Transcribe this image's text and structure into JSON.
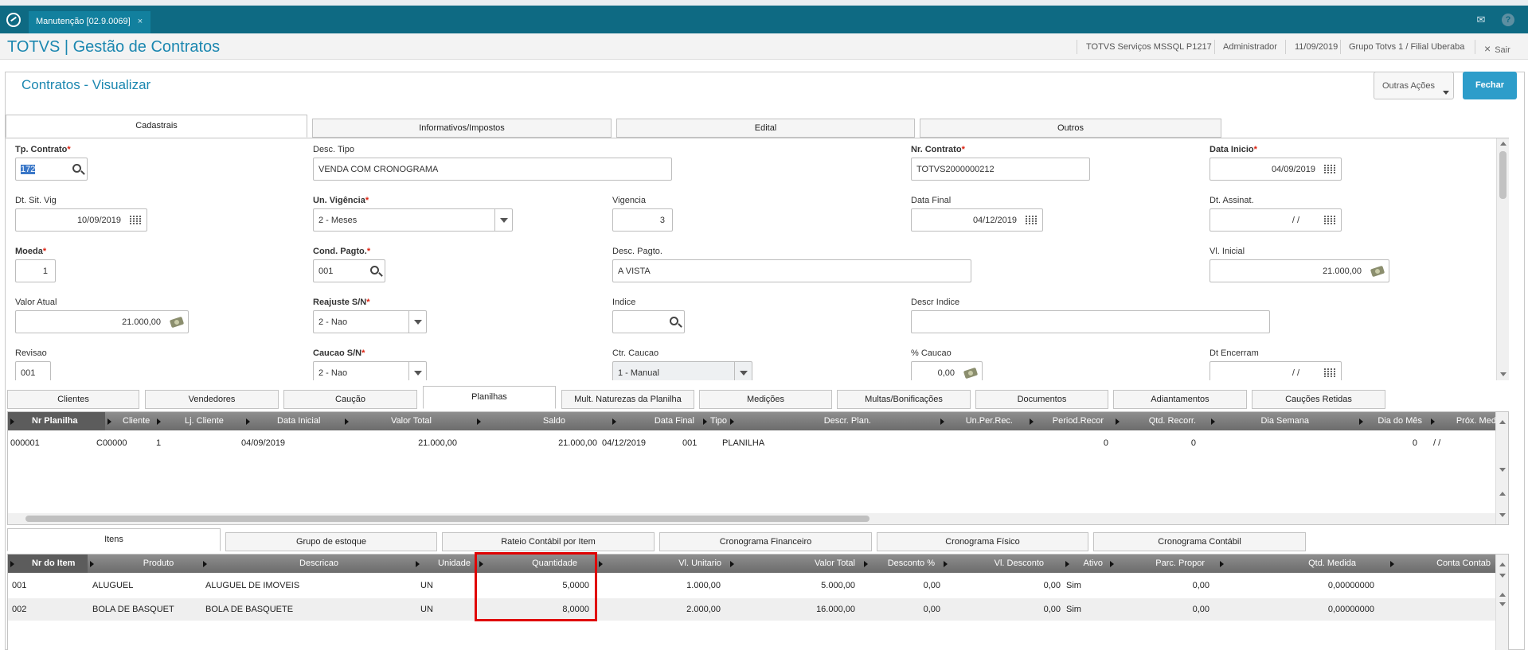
{
  "window": {
    "tab_label": "Manutenção [02.9.0069]",
    "tab_close": "×"
  },
  "header": {
    "title": "TOTVS | Gestão de Contratos",
    "company": "TOTVS Serviços MSSQL P1217",
    "user": "Administrador",
    "date": "11/09/2019",
    "branch": "Grupo Totvs 1 / Filial Uberaba",
    "exit_label": "Sair",
    "exit_icon": "×"
  },
  "page": {
    "title": "Contratos - Visualizar",
    "actions_label": "Outras Ações",
    "close_label": "Fechar"
  },
  "top_tabs": [
    "Cadastrais",
    "Informativos/Impostos",
    "Edital",
    "Outros"
  ],
  "form": {
    "tp_contrato": {
      "label": "Tp. Contrato",
      "value": "172"
    },
    "desc_tipo": {
      "label": "Desc. Tipo",
      "value": "VENDA COM CRONOGRAMA"
    },
    "nr_contrato": {
      "label": "Nr. Contrato",
      "value": "TOTVS2000000212"
    },
    "data_inicio": {
      "label": "Data Inicio",
      "value": "04/09/2019"
    },
    "dt_sit_vig": {
      "label": "Dt. Sit. Vig",
      "value": "10/09/2019"
    },
    "un_vigencia": {
      "label": "Un. Vigência",
      "value": "2 - Meses"
    },
    "vigencia": {
      "label": "Vigencia",
      "value": "3"
    },
    "data_final": {
      "label": "Data Final",
      "value": "04/12/2019"
    },
    "dt_assinat": {
      "label": "Dt. Assinat.",
      "value": "/ /"
    },
    "moeda": {
      "label": "Moeda",
      "value": "1"
    },
    "cond_pagto": {
      "label": "Cond. Pagto.",
      "value": "001"
    },
    "desc_pagto": {
      "label": "Desc. Pagto.",
      "value": "A VISTA"
    },
    "vl_inicial": {
      "label": "Vl. Inicial",
      "value": "21.000,00"
    },
    "valor_atual": {
      "label": "Valor Atual",
      "value": "21.000,00"
    },
    "reajuste": {
      "label": "Reajuste S/N",
      "value": "2 - Nao"
    },
    "indice": {
      "label": "Indice",
      "value": ""
    },
    "descr_indice": {
      "label": "Descr Indice",
      "value": ""
    },
    "revisao": {
      "label": "Revisao",
      "value": "001"
    },
    "caucao": {
      "label": "Caucao S/N",
      "value": "2 - Nao"
    },
    "ctr_caucao": {
      "label": "Ctr. Caucao",
      "value": "1 - Manual"
    },
    "pct_caucao": {
      "label": "% Caucao",
      "value": "0,00"
    },
    "dt_encerram": {
      "label": "Dt Encerram",
      "value": "/ /"
    }
  },
  "mid_tabs": [
    "Clientes",
    "Vendedores",
    "Caução",
    "Planilhas",
    "Mult. Naturezas da Planilha",
    "Medições",
    "Multas/Bonificações",
    "Documentos",
    "Adiantamentos",
    "Cauções Retidas"
  ],
  "planilhas_grid": {
    "columns": [
      "Nr Planilha",
      "Cliente",
      "Lj. Cliente",
      "Data Inicial",
      "Valor Total",
      "Saldo",
      "Data Final",
      "Tipo",
      "Descr. Plan.",
      "Un.Per.Rec.",
      "Period.Recor",
      "Qtd. Recorr.",
      "Dia Semana",
      "Dia do Mês",
      "Próx. Med."
    ],
    "rows": [
      [
        "000001",
        "C00000",
        "1",
        "04/09/2019",
        "21.000,00",
        "21.000,00",
        "04/12/2019",
        "001",
        "PLANILHA",
        "",
        "0",
        "0",
        "",
        "0",
        "/ /"
      ]
    ]
  },
  "bottom_tabs": [
    "Itens",
    "Grupo de estoque",
    "Rateio Contábil por Item",
    "Cronograma Financeiro",
    "Cronograma Físico",
    "Cronograma Contábil"
  ],
  "itens_grid": {
    "columns": [
      "Nr do Item",
      "Produto",
      "Descricao",
      "Unidade",
      "Quantidade",
      "Vl. Unitario",
      "Valor Total",
      "Desconto %",
      "Vl. Desconto",
      "Ativo",
      "Parc. Propor",
      "Qtd. Medida",
      "Conta Contab"
    ],
    "rows": [
      [
        "001",
        "ALUGUEL",
        "ALUGUEL DE IMOVEIS",
        "UN",
        "5,0000",
        "1.000,00",
        "5.000,00",
        "0,00",
        "0,00",
        "Sim",
        "0,00",
        "0,00000000",
        ""
      ],
      [
        "002",
        "BOLA DE BASQUET",
        "BOLA DE BASQUETE",
        "UN",
        "8,0000",
        "2.000,00",
        "16.000,00",
        "0,00",
        "0,00",
        "Sim",
        "0,00",
        "0,00000000",
        ""
      ]
    ]
  },
  "colors": {
    "topbar": "#0e6a83",
    "accent": "#1b87b0",
    "primary_button": "#2d9dca",
    "highlight_box": "#e00000"
  }
}
